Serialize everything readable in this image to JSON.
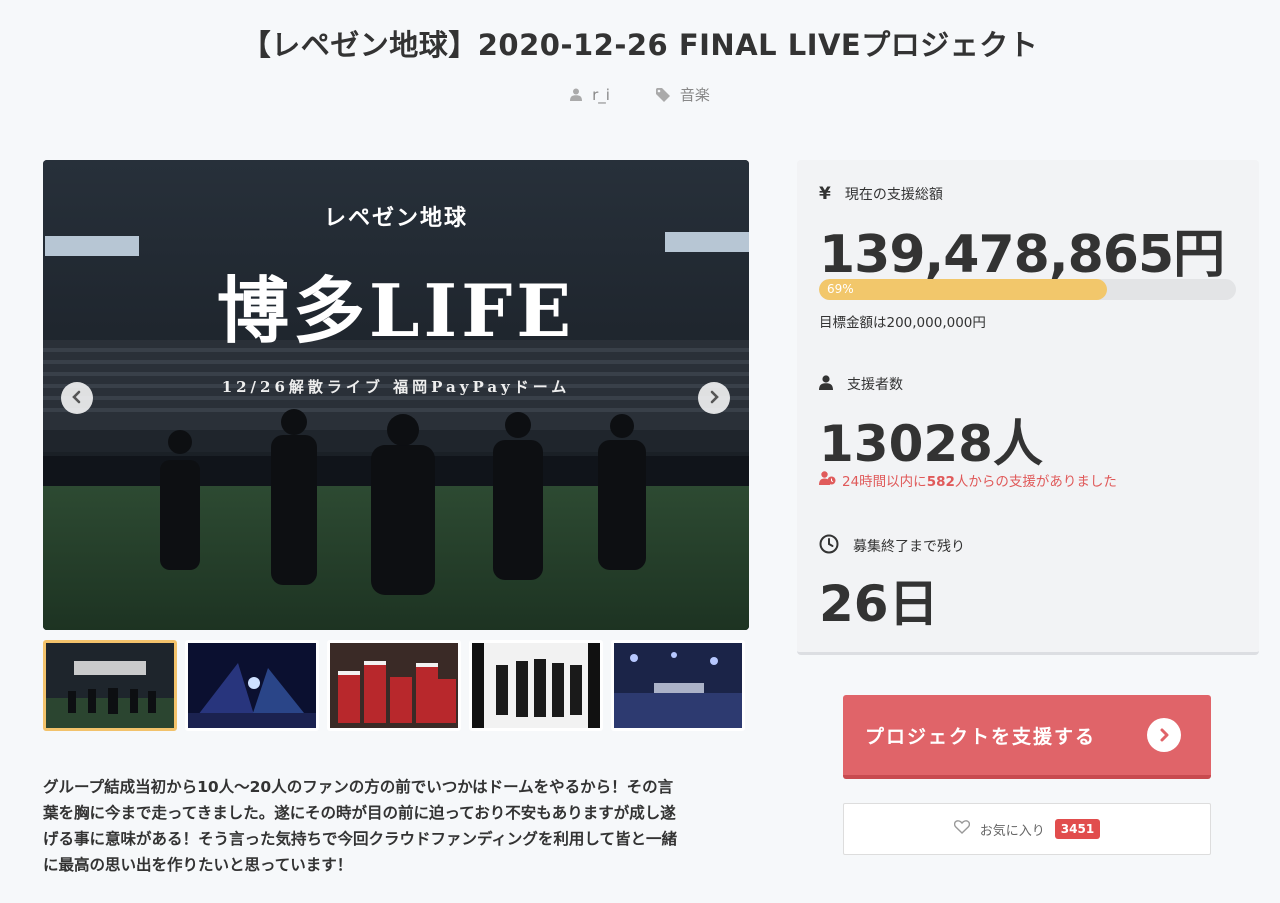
{
  "title": "【レペゼン地球】2020-12-26 FINAL LIVEプロジェクト",
  "meta": {
    "author": "r_i",
    "category": "音楽",
    "author_icon": "user-icon",
    "category_icon": "tag-icon"
  },
  "hero": {
    "logo_text": "レペゼン地球",
    "big_text": "博多LIFE",
    "sub_text": "12/26解散ライブ 福岡PayPayドーム",
    "prev_icon": "chevron-left-icon",
    "next_icon": "chevron-right-icon"
  },
  "thumbnails": [
    {
      "name": "thumb-1",
      "active": true
    },
    {
      "name": "thumb-2",
      "active": false
    },
    {
      "name": "thumb-3",
      "active": false
    },
    {
      "name": "thumb-4",
      "active": false
    },
    {
      "name": "thumb-5",
      "active": false
    }
  ],
  "description": {
    "line1": "グループ結成当初から10人～20人のファンの方の前でいつかはドームをやるから！その言",
    "line2": "葉を胸に今まで走ってきました。遂にその時が目の前に迫っており不安もありますが成し遂",
    "line3": "げる事に意味がある！そう言った気持ちで今回クラウドファンディングを利用して皆と一緒",
    "line4": "に最高の思い出を作りたいと思っています！"
  },
  "stats": {
    "total_label": "現在の支援総額",
    "total_icon": "yen-icon",
    "total_value": "139,478,865円",
    "progress_percent": 69,
    "progress_label": "69%",
    "goal_text": "目標金額は200,000,000円",
    "supporters_label": "支援者数",
    "supporters_icon": "user-icon",
    "supporters_value": "13028人",
    "recent_prefix": "24時間以内に",
    "recent_count": "582",
    "recent_suffix": "人からの支援がありました",
    "recent_icon": "user-clock-icon",
    "remaining_label": "募集終了まで残り",
    "remaining_icon": "clock-icon",
    "remaining_value": "26日"
  },
  "cta": {
    "label": "プロジェクトを支援する",
    "icon": "chevron-right-circle-icon"
  },
  "favorite": {
    "label": "お気に入り",
    "count": "3451",
    "icon": "heart-icon"
  },
  "colors": {
    "accent": "#e06469",
    "progress": "#f2c76b",
    "alert": "#e05a5a",
    "badge": "#e14d4d"
  }
}
